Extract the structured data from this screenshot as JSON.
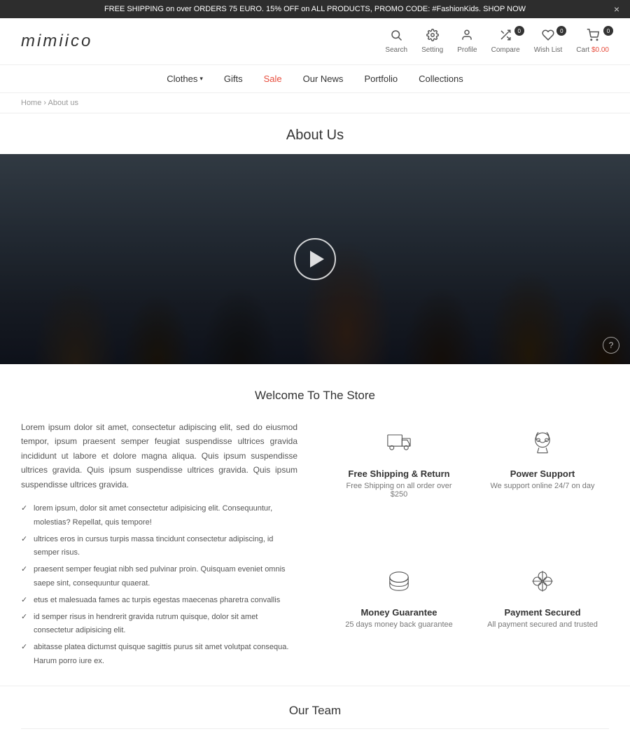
{
  "banner": {
    "text": "FREE SHIPPING on over ORDERS 75 EURO. 15% OFF on ALL PRODUCTS, PROMO CODE: #FashionKids. SHOP NOW",
    "close_label": "×"
  },
  "header": {
    "logo": "mimiico",
    "icons": [
      {
        "id": "search",
        "label": "Search",
        "badge": null,
        "symbol": "🔍"
      },
      {
        "id": "setting",
        "label": "Setting",
        "badge": null,
        "symbol": "⚙"
      },
      {
        "id": "profile",
        "label": "Profile",
        "badge": null,
        "symbol": "👤"
      },
      {
        "id": "compare",
        "label": "Compare",
        "badge": "0",
        "symbol": "⚖"
      },
      {
        "id": "wishlist",
        "label": "Wish List",
        "badge": "0",
        "symbol": "♡"
      },
      {
        "id": "cart",
        "label": "Cart",
        "badge": "0",
        "price": "$0.00"
      }
    ]
  },
  "nav": {
    "items": [
      {
        "label": "Clothes",
        "has_dropdown": true,
        "class": ""
      },
      {
        "label": "Gifts",
        "has_dropdown": false,
        "class": ""
      },
      {
        "label": "Sale",
        "has_dropdown": false,
        "class": "sale"
      },
      {
        "label": "Our News",
        "has_dropdown": false,
        "class": ""
      },
      {
        "label": "Portfolio",
        "has_dropdown": false,
        "class": ""
      },
      {
        "label": "Collections",
        "has_dropdown": false,
        "class": ""
      }
    ]
  },
  "breadcrumb": {
    "home_label": "Home",
    "current": "About us"
  },
  "page": {
    "title": "About Us"
  },
  "video": {
    "play_tooltip": "Play video",
    "help_tooltip": "?"
  },
  "welcome": {
    "title": "Welcome To The Store",
    "paragraph": "Lorem ipsum dolor sit amet, consectetur adipiscing elit, sed do eiusmod tempor, ipsum praesent semper feugiat suspendisse ultrices gravida incididunt ut labore et dolore magna aliqua. Quis ipsum suspendisse ultrices gravida. Quis ipsum suspendisse ultrices gravida. Quis ipsum suspendisse ultrices gravida.",
    "checklist": [
      "lorem ipsum, dolor sit amet consectetur adipisicing elit. Consequuntur, molestias? Repellat, quis tempore!",
      "ultrices eros in cursus turpis massa tincidunt consectetur adipiscing, id semper risus.",
      "praesent semper feugiat nibh sed pulvinar proin. Quisquam eveniet omnis saepe sint, consequuntur quaerat.",
      "etus et malesuada fames ac turpis egestas maecenas pharetra convallis",
      "id semper risus in hendrerit gravida rutrum quisque, dolor sit amet consectetur adipisicing elit.",
      "abitasse platea dictumst quisque sagittis purus sit amet volutpat consequa. Harum porro iure ex."
    ],
    "features": [
      {
        "id": "shipping",
        "title": "Free Shipping & Return",
        "desc": "Free Shipping on all order over $250"
      },
      {
        "id": "support",
        "title": "Power Support",
        "desc": "We support online 24/7 on day"
      },
      {
        "id": "money",
        "title": "Money Guarantee",
        "desc": "25 days money back guarantee"
      },
      {
        "id": "payment",
        "title": "Payment Secured",
        "desc": "All payment secured and trusted"
      }
    ]
  },
  "team": {
    "title": "Our Team"
  }
}
